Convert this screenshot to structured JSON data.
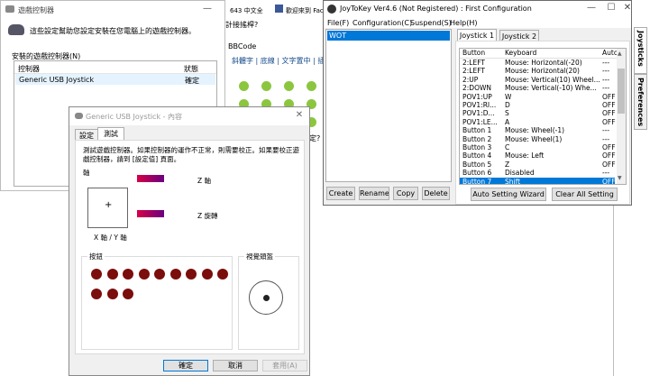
{
  "game_ctrl": {
    "title": "遊戲控制器",
    "description": "這些設定幫助您設定安裝在您電腦上的遊戲控制器。",
    "installed_label": "安裝的遊戲控制器(N)",
    "col_controller": "控制器",
    "col_status": "狀態",
    "rows": [
      {
        "controller": "Generic USB Joystick",
        "status": "確定"
      }
    ]
  },
  "bg_browser": {
    "top_text": "643 中文全",
    "link1": "歡迎來到 Fac",
    "heading": "計接搖桿?",
    "bbcode": "BBCode",
    "format_bar": "斜體字 | 底線 | 文字置中 | 插入連",
    "question": "定?"
  },
  "props": {
    "title": "Generic USB Joystick - 內容",
    "tabs": [
      "設定",
      "測試"
    ],
    "instruction": "測試遊戲控制器。如果控制器的運作不正常，則需要校正。如果要校正遊戲控制器，請到 [設定值] 頁面。",
    "axes_label": "軸",
    "crosshair": "+",
    "xy_label": "X 軸 / Y 軸",
    "z_axis": "Z 軸",
    "z_rot": "Z 旋轉",
    "buttons_label": "按鈕",
    "button_count": 12,
    "pov_label": "視覺頭盔",
    "ok": "確定",
    "cancel": "取消",
    "apply": "套用(A)"
  },
  "joy": {
    "title": "JoyToKey Ver4.6 (Not Registered) : First Configuration",
    "menu": [
      "File(F)",
      "Configuration(C)",
      "Suspend(S)",
      "Help(H)"
    ],
    "configs": [
      "WOT"
    ],
    "buttons": [
      "Create",
      "Rename",
      "Copy",
      "Delete"
    ],
    "tabs": [
      "Joystick 1",
      "Joystick 2"
    ],
    "side_tabs": [
      "Joysticks",
      "Preferences"
    ],
    "col_button": "Button",
    "col_keyboard": "Keyboard",
    "col_auto": "Auto",
    "rows": [
      {
        "button": "2:LEFT",
        "keyboard": "Mouse: Horizontal(-20)",
        "auto": "---"
      },
      {
        "button": "2:LEFT",
        "keyboard": "Mouse: Horizontal(20)",
        "auto": "---"
      },
      {
        "button": "2:UP",
        "keyboard": "Mouse: Vertical(10) Wheel...",
        "auto": "---"
      },
      {
        "button": "2:DOWN",
        "keyboard": "Mouse: Vertical(-10) Whe...",
        "auto": "---"
      },
      {
        "button": "POV1:UP",
        "keyboard": "W",
        "auto": "OFF"
      },
      {
        "button": "POV1:RI...",
        "keyboard": "D",
        "auto": "OFF"
      },
      {
        "button": "POV1:D...",
        "keyboard": "S",
        "auto": "OFF"
      },
      {
        "button": "POV1:LE...",
        "keyboard": "A",
        "auto": "OFF"
      },
      {
        "button": "Button 1",
        "keyboard": "Mouse: Wheel(-1)",
        "auto": "---"
      },
      {
        "button": "Button 2",
        "keyboard": "Mouse: Wheel(1)",
        "auto": "---"
      },
      {
        "button": "Button 3",
        "keyboard": "C",
        "auto": "OFF"
      },
      {
        "button": "Button 4",
        "keyboard": "Mouse: Left",
        "auto": "OFF"
      },
      {
        "button": "Button 5",
        "keyboard": "Z",
        "auto": "OFF"
      },
      {
        "button": "Button 6",
        "keyboard": "Disabled",
        "auto": "---"
      },
      {
        "button": "Button 7",
        "keyboard": "Shift",
        "auto": "OFF"
      }
    ],
    "selected_row": 14,
    "auto_setting": "Auto Setting Wizard",
    "clear_all": "Clear All Setting",
    "accent": "#0078d7"
  }
}
